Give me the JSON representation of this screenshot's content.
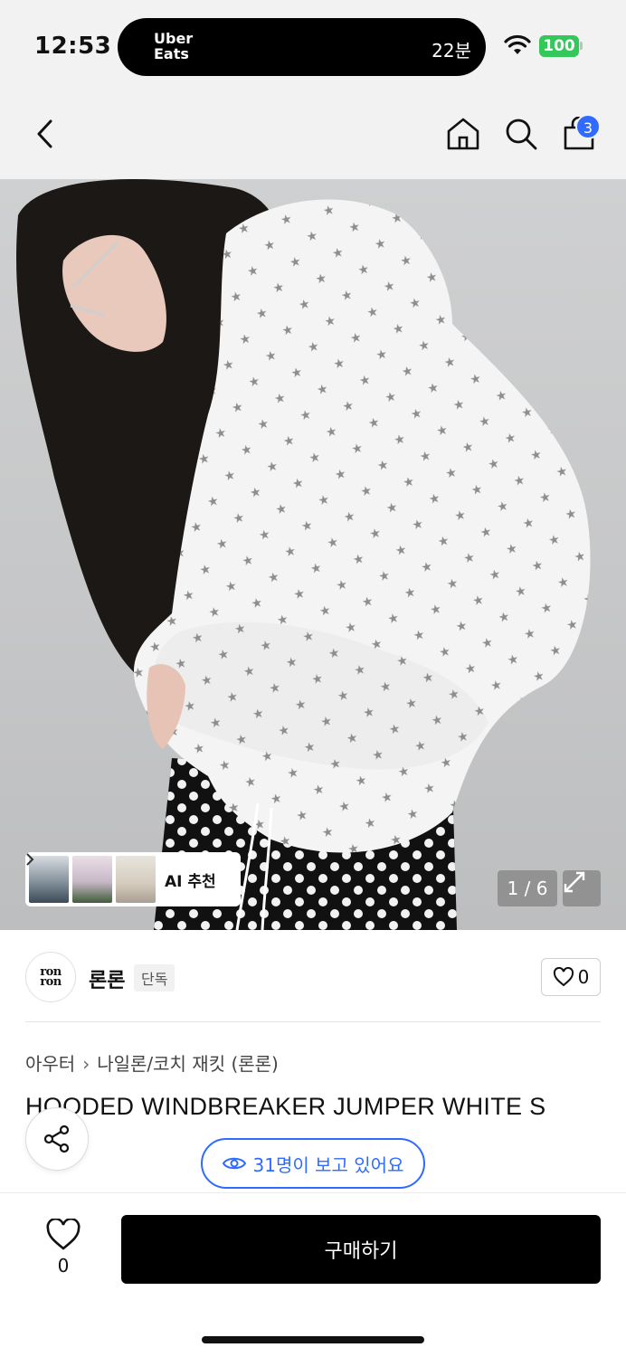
{
  "status_bar": {
    "time": "12:53",
    "live_activity": {
      "app_line1": "Uber",
      "app_line2": "Eats",
      "eta": "22분"
    },
    "battery": "100",
    "icons": [
      "wifi-icon",
      "battery-icon"
    ]
  },
  "nav": {
    "icons": [
      "back-icon",
      "home-icon",
      "search-icon",
      "cart-icon"
    ],
    "cart_count": "3"
  },
  "hero": {
    "ai_recommend_label": "AI 추천",
    "page_indicator": "1 / 6",
    "icons": [
      "expand-icon",
      "chevron-right-icon"
    ]
  },
  "brand": {
    "logo_line1": "ron",
    "logo_line2": "ron",
    "name": "론론",
    "badge": "단독",
    "like_count": "0"
  },
  "product": {
    "breadcrumb": [
      "아우터",
      "나일론/코치 재킷 (론론)"
    ],
    "title": "HOODED WINDBREAKER JUMPER WHITE S",
    "viewers": "31명이 보고 있어요"
  },
  "bottom_bar": {
    "wish_count": "0",
    "buy_label": "구매하기"
  },
  "colors": {
    "accent": "#2f6bff",
    "battery": "#34c759",
    "buy_button": "#000000"
  }
}
